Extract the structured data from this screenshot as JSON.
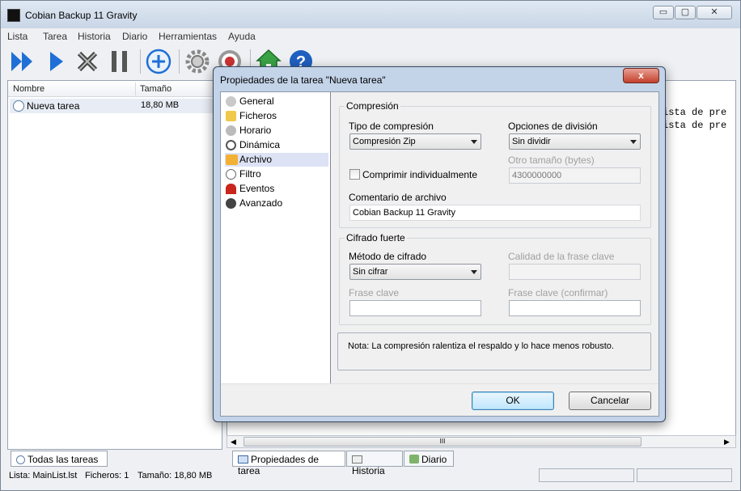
{
  "window": {
    "title": "Cobian Backup 11 Gravity",
    "controls": [
      "▭",
      "▢",
      "✕"
    ]
  },
  "menu": [
    "Lista",
    "Tarea",
    "Historia",
    "Diario",
    "Herramientas",
    "Ayuda"
  ],
  "toolbar": [
    "run-all-icon",
    "run-icon",
    "stop-icon",
    "pause-icon",
    "add-task-icon",
    "settings-icon",
    "target-icon",
    "home-icon",
    "help-icon"
  ],
  "list": {
    "col_name": "Nombre",
    "col_size": "Tamaño",
    "task_name": "Nueva tarea",
    "task_size": "18,80 MB"
  },
  "log_lines": [
    "ista de pre",
    "ista de pre"
  ],
  "log_partial": "...",
  "left_tab": "Todas las tareas",
  "right_tabs": [
    "Propiedades de tarea",
    "Historia",
    "Diario"
  ],
  "scroll_grip": "III",
  "status": {
    "list": "Lista: MainList.lst",
    "files": "Ficheros: 1",
    "size": "Tamaño: 18,80 MB"
  },
  "dialog": {
    "title": "Propiedades de la tarea \"Nueva tarea\"",
    "close": "x",
    "nav": [
      "General",
      "Ficheros",
      "Horario",
      "Dinámica",
      "Archivo",
      "Filtro",
      "Eventos",
      "Avanzado"
    ],
    "nav_selected": "Archivo",
    "compression": {
      "group": "Compresión",
      "type_label": "Tipo de compresión",
      "type_value": "Compresión Zip",
      "split_label": "Opciones de división",
      "split_value": "Sin dividir",
      "other_size_label": "Otro tamaño (bytes)",
      "other_size_value": "4300000000",
      "individual_label": "Comprimir individualmente",
      "comment_label": "Comentario de archivo",
      "comment_value": "Cobian Backup 11 Gravity"
    },
    "encryption": {
      "group": "Cifrado fuerte",
      "method_label": "Método de cifrado",
      "method_value": "Sin cifrar",
      "quality_label": "Calidad de la frase clave",
      "pass_label": "Frase clave",
      "pass_confirm_label": "Frase clave (confirmar)"
    },
    "note": "Nota: La compresión ralentiza el respaldo y lo hace menos robusto.",
    "ok": "OK",
    "cancel": "Cancelar"
  }
}
